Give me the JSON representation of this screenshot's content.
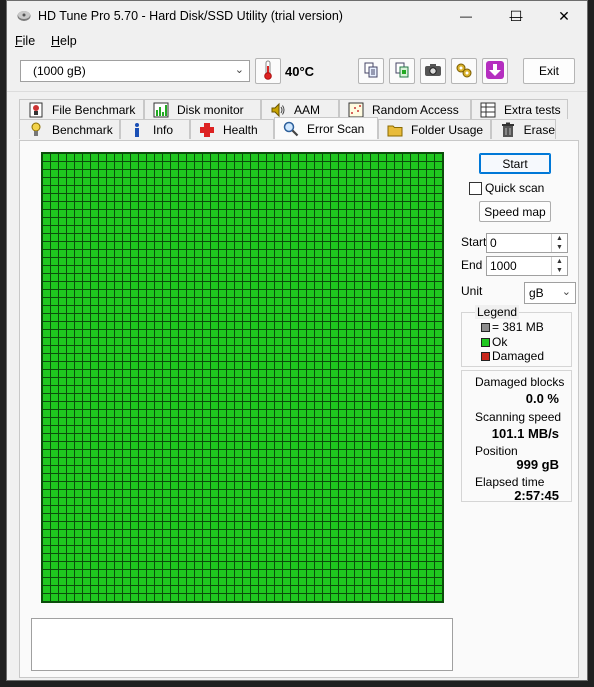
{
  "window": {
    "title": "HD Tune Pro 5.70 - Hard Disk/SSD Utility (trial version)",
    "controls": {
      "minimize": "—",
      "maximize": "☐",
      "close": "✕"
    }
  },
  "menu": [
    {
      "label": "File",
      "accel": "F",
      "rest": "ile"
    },
    {
      "label": "Help",
      "accel": "H",
      "rest": "elp"
    }
  ],
  "toolbar": {
    "drive": "(1000 gB)",
    "temperature": "40°C",
    "exit_label": "Exit",
    "icons": [
      "copy-info-icon",
      "copy-screen-icon",
      "screenshot-camera-icon",
      "options-tools-icon",
      "save-download-icon"
    ]
  },
  "tabs": {
    "row1": [
      "File Benchmark",
      "Disk monitor",
      "AAM",
      "Random Access",
      "Extra tests"
    ],
    "row2": [
      "Benchmark",
      "Info",
      "Health",
      "Error Scan",
      "Folder Usage",
      "Erase"
    ],
    "active": "Error Scan"
  },
  "controls": {
    "start_label": "Start",
    "quick_scan_label": "Quick scan",
    "quick_scan_checked": false,
    "speed_map_label": "Speed map",
    "start_field_label": "Start",
    "start_value": "0",
    "end_field_label": "End",
    "end_value": "1000",
    "unit_label": "Unit",
    "unit_value": "gB"
  },
  "legend": {
    "title": "Legend",
    "block_size": "= 381 MB",
    "ok": "Ok",
    "damaged": "Damaged",
    "colors": {
      "block": "#8c8c8c",
      "ok": "#1fc71f",
      "damaged": "#c8281e"
    }
  },
  "stats": {
    "damaged_blocks_label": "Damaged blocks",
    "damaged_blocks_value": "0.0 %",
    "scanning_speed_label": "Scanning speed",
    "scanning_speed_value": "101.1 MB/s",
    "position_label": "Position",
    "position_value": "999 gB",
    "elapsed_label": "Elapsed time",
    "elapsed_value": "2:57:45"
  }
}
